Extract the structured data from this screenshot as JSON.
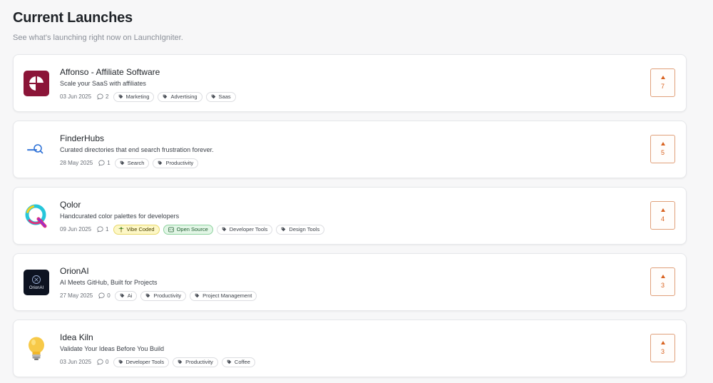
{
  "header": {
    "title": "Current Launches",
    "subtitle": "See what's launching right now on LaunchIgniter."
  },
  "launches": [
    {
      "name": "Affonso - Affiliate Software",
      "tagline": "Scale your SaaS with affiliates",
      "date": "03 Jun 2025",
      "comments": "2",
      "badges": [],
      "tags": [
        "Marketing",
        "Advertising",
        "Saas"
      ],
      "votes": "7",
      "logo_icon": "affonso-logo",
      "logo_color": "#8b1538"
    },
    {
      "name": "FinderHubs",
      "tagline": "Curated directories that end search frustration forever.",
      "date": "28 May 2025",
      "comments": "1",
      "badges": [],
      "tags": [
        "Search",
        "Productivity"
      ],
      "votes": "5",
      "logo_icon": "finderhubs-logo",
      "logo_color": "#2a6fd6"
    },
    {
      "name": "Qolor",
      "tagline": "Handcurated color palettes for developers",
      "date": "09 Jun 2025",
      "comments": "1",
      "badges": [
        "Vibe Coded",
        "Open Source"
      ],
      "tags": [
        "Developer Tools",
        "Design Tools"
      ],
      "votes": "4",
      "logo_icon": "qolor-logo",
      "logo_color": "#e0307a"
    },
    {
      "name": "OrionAI",
      "tagline": "AI Meets GitHub, Built for Projects",
      "date": "27 May 2025",
      "comments": "0",
      "badges": [],
      "tags": [
        "Ai",
        "Productivity",
        "Project Management"
      ],
      "votes": "3",
      "logo_icon": "orionai-logo",
      "logo_text": "OrionAI",
      "logo_color": "#0d1321"
    },
    {
      "name": "Idea Kiln",
      "tagline": "Validate Your Ideas Before You Build",
      "date": "03 Jun 2025",
      "comments": "0",
      "badges": [],
      "tags": [
        "Developer Tools",
        "Productivity",
        "Coffee"
      ],
      "votes": "3",
      "logo_icon": "lightbulb-icon",
      "logo_color": "#f7c948"
    }
  ],
  "colors": {
    "accent": "#d8621f",
    "vibe_badge_bg": "#fdf7c6",
    "open_source_badge_bg": "#e2f6e6"
  }
}
